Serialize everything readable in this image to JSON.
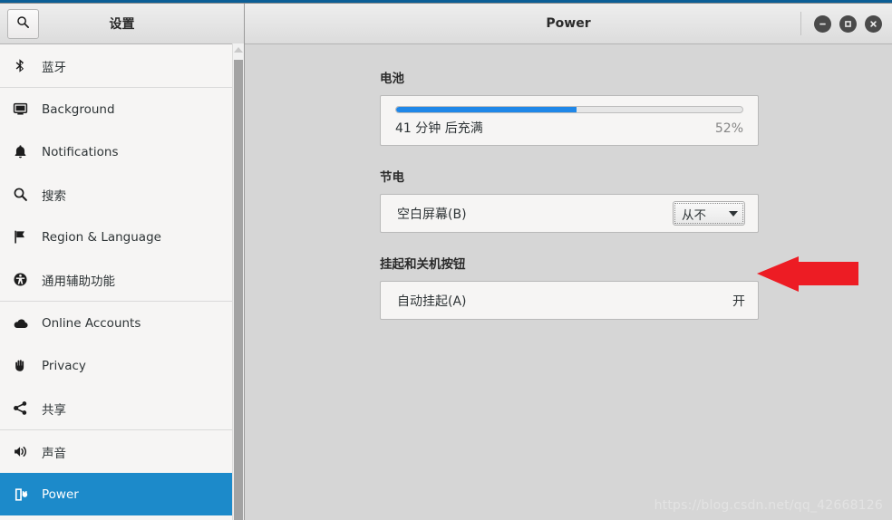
{
  "window": {
    "title": "Power",
    "controls": [
      {
        "name": "minimize",
        "glyph": "minimize-icon"
      },
      {
        "name": "maximize",
        "glyph": "maximize-icon"
      },
      {
        "name": "close",
        "glyph": "close-icon"
      }
    ]
  },
  "sidebar": {
    "title": "设置",
    "search_icon": "search-icon",
    "items": [
      {
        "label": "蓝牙",
        "icon": "bluetooth-icon",
        "selected": false,
        "sep_after": true
      },
      {
        "label": "Background",
        "icon": "monitor-icon",
        "selected": false,
        "sep_after": false
      },
      {
        "label": "Notifications",
        "icon": "bell-icon",
        "selected": false,
        "sep_after": false
      },
      {
        "label": "搜索",
        "icon": "search-icon",
        "selected": false,
        "sep_after": false
      },
      {
        "label": "Region & Language",
        "icon": "flag-icon",
        "selected": false,
        "sep_after": false
      },
      {
        "label": "通用辅助功能",
        "icon": "accessibility-icon",
        "selected": false,
        "sep_after": true
      },
      {
        "label": "Online Accounts",
        "icon": "cloud-icon",
        "selected": false,
        "sep_after": false
      },
      {
        "label": "Privacy",
        "icon": "hand-icon",
        "selected": false,
        "sep_after": false
      },
      {
        "label": "共享",
        "icon": "share-icon",
        "selected": false,
        "sep_after": true
      },
      {
        "label": "声音",
        "icon": "speaker-icon",
        "selected": false,
        "sep_after": false
      },
      {
        "label": "Power",
        "icon": "power-plug-icon",
        "selected": true,
        "sep_after": false
      }
    ]
  },
  "main": {
    "battery": {
      "heading": "电池",
      "status_text": "41 分钟 后充满",
      "percent_label": "52%",
      "percent_value": 52
    },
    "power_saving": {
      "heading": "节电",
      "blank_screen": {
        "label": "空白屏幕(B)",
        "value": "从不"
      }
    },
    "suspend": {
      "heading": "挂起和关机按钮",
      "automatic_suspend": {
        "label": "自动挂起(A)",
        "value": "开"
      }
    }
  },
  "annotation": {
    "arrow_color": "#ed1c24"
  },
  "watermark": {
    "text": "https://blog.csdn.net/qq_42668126"
  },
  "colors": {
    "accent_blue": "#1c8aca",
    "progress_blue": "#1f87e8",
    "arrow_red": "#ed1c24"
  }
}
